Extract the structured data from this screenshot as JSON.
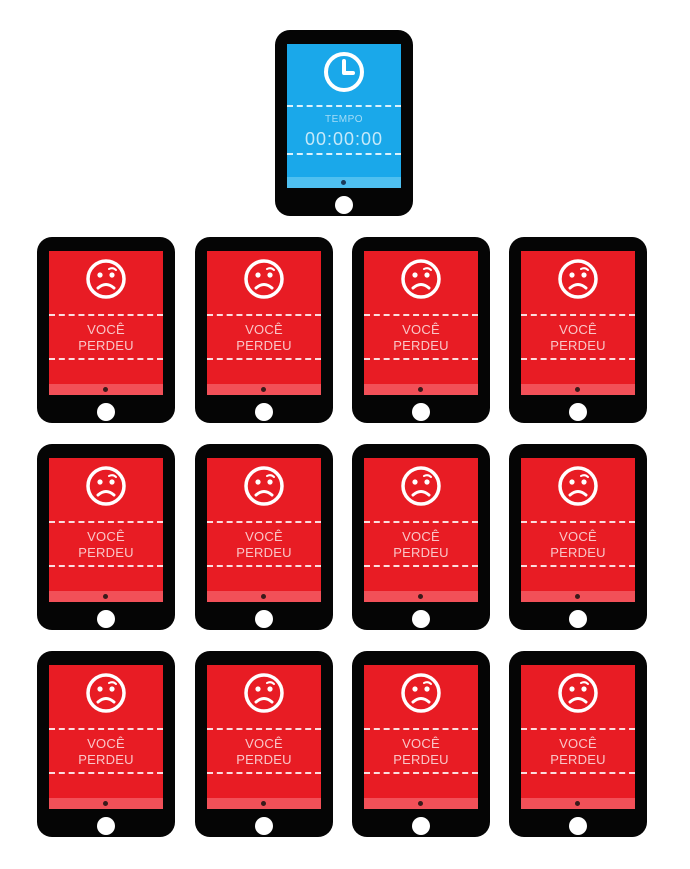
{
  "timer_device": {
    "icon": "clock-icon",
    "label": "TEMPO",
    "time": "00:00:00",
    "color": "#1aa8ea"
  },
  "lost_devices": {
    "icon": "sad-face-icon",
    "line1": "VOCÊ",
    "line2": "PERDEU",
    "color": "#e81c24",
    "count": 12
  }
}
